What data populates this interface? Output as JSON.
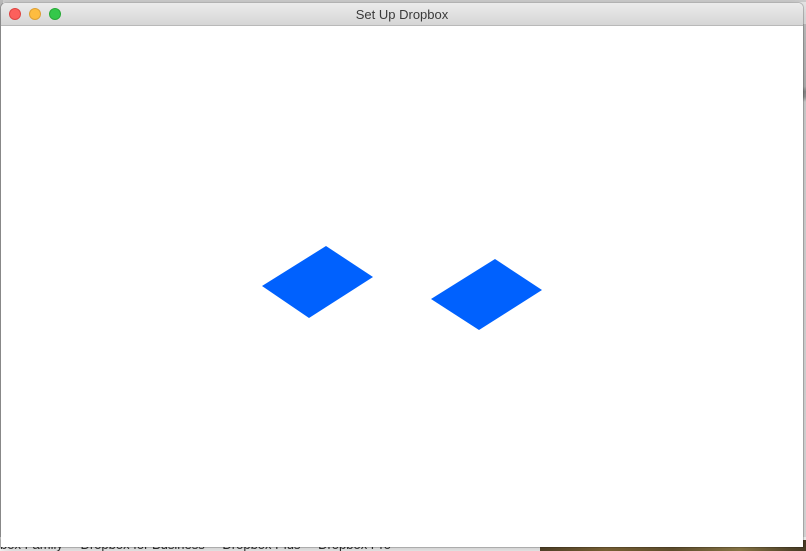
{
  "window": {
    "title": "Set Up Dropbox"
  },
  "background": {
    "footer_links": [
      "box Family",
      "Dropbox for Business",
      "Dropbox Plus",
      "Dropbox Pro"
    ]
  },
  "logo": {
    "icon": "dropbox-logo-icon",
    "color": "#0061fe"
  }
}
